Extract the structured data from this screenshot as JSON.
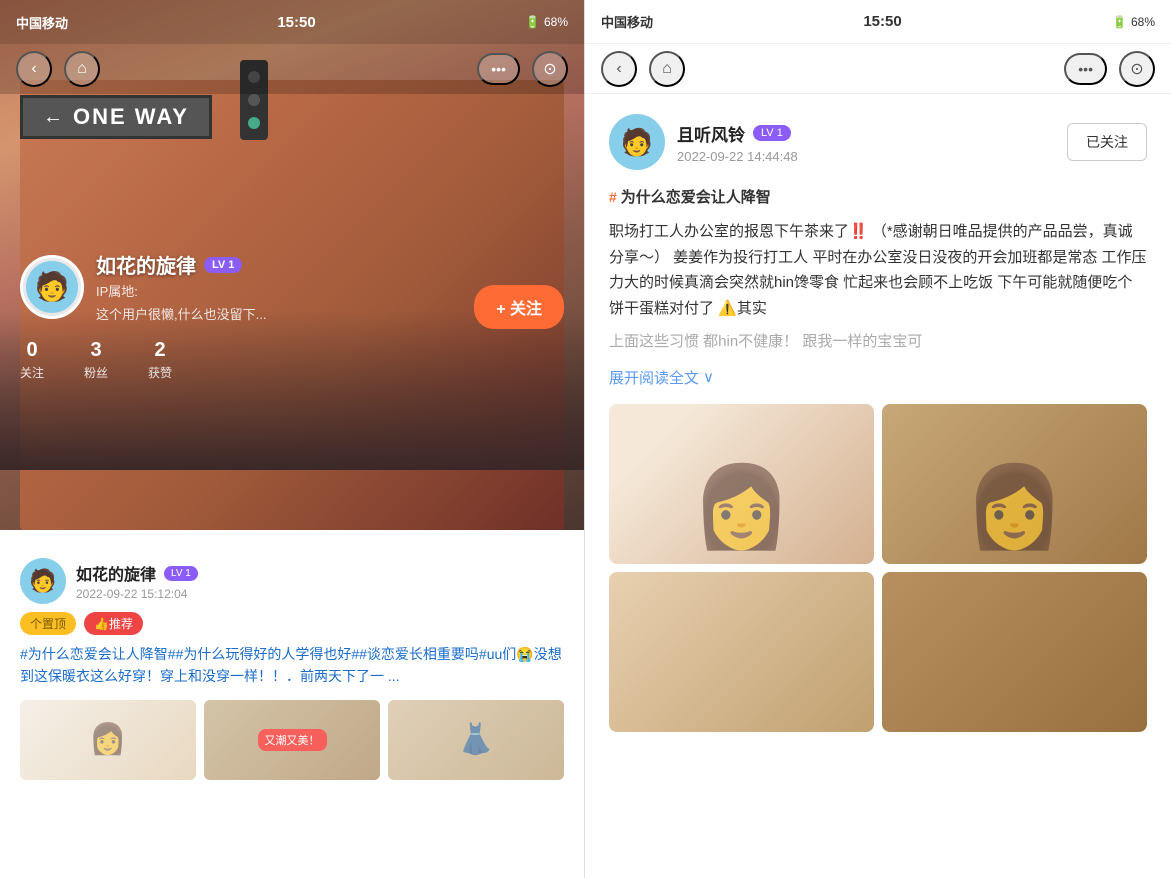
{
  "left_phone": {
    "status_bar": {
      "carrier": "中国移动",
      "wifi": "WiFi",
      "time": "15:50",
      "battery": "68%"
    },
    "nav": {
      "back_label": "‹",
      "home_label": "⌂",
      "more_label": "•••",
      "target_label": "⊙"
    },
    "street_sign": {
      "arrow": "←",
      "text": "ONE WAY"
    },
    "profile": {
      "username": "如花的旋律",
      "lv_badge": "LV 1",
      "ip_label": "IP属地:",
      "bio": "这个用户很懒,什么也没留下...",
      "following": "0",
      "following_label": "关注",
      "followers": "3",
      "followers_label": "粉丝",
      "likes": "2",
      "likes_label": "获赞",
      "follow_btn": "+ 关注"
    },
    "post": {
      "username": "如花的旋律",
      "lv_badge": "LV 1",
      "time": "2022-09-22 15:12:04",
      "pin_badge": "个置顶",
      "rec_badge": "👍推荐",
      "content": "#为什么恋爱会让人降智##为什么玩得好的人学得也好##谈恋爱长相重要吗#uu们😭没想到这保暖衣这么好穿！穿上和没穿一样！！．前两天下了一 ..."
    }
  },
  "right_phone": {
    "status_bar": {
      "carrier": "中国移动",
      "wifi": "WiFi",
      "time": "15:50",
      "battery": "68%"
    },
    "nav": {
      "back_label": "‹",
      "home_label": "⌂",
      "more_label": "•••",
      "target_label": "⊙"
    },
    "author": {
      "username": "且听风铃",
      "lv_badge": "LV 1",
      "time": "2022-09-22 14:44:48",
      "follow_btn": "已关注"
    },
    "post": {
      "tag_icon": "#",
      "tag_title": "为什么恋爱会让人降智",
      "content_line1": "职场打工人办公室的报恩下午茶来了‼️ （*感谢朝日唯品提供的产品品尝，真诚分享～）    姜姜作为投行打工人   平时在办公室没日没夜的开会加班都是常态   工作压力大的时候真滴会突然就hin馋零食   忙起来也会顾不上吃饭   下午可能就随便吃个饼干蛋糕对付了  ⚠️其实",
      "content_fade": "上面这些习惯  都hin不健康！  跟我一样的宝宝可",
      "expand_btn": "展开阅读全文",
      "expand_icon": "∨"
    }
  }
}
